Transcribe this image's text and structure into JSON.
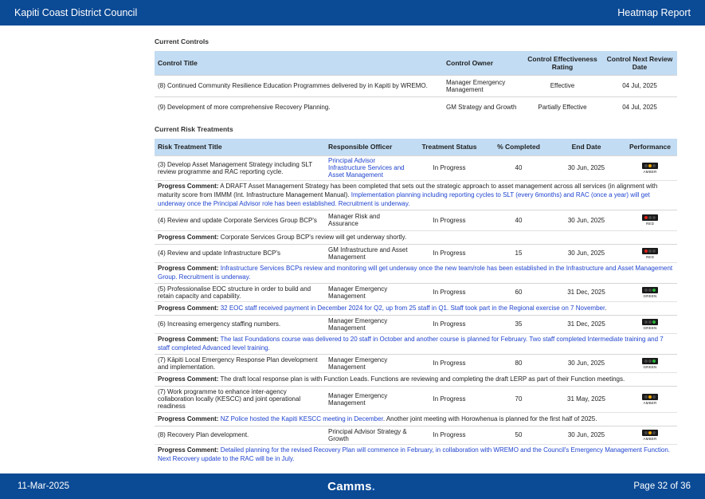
{
  "header": {
    "org": "Kapiti Coast District Council",
    "report": "Heatmap Report"
  },
  "footer": {
    "date": "11-Mar-2025",
    "brand": "Camms",
    "brand_dot": ".",
    "page": "Page 32 of 36"
  },
  "controls": {
    "section_title": "Current Controls",
    "columns": [
      "Control Title",
      "Control Owner",
      "Control Effectiveness Rating",
      "Control Next Review Date"
    ],
    "rows": [
      {
        "title": "(8) Continued Community Resilience Education Programmes delivered by in Kapiti by WREMO.",
        "owner": "Manager Emergency Management",
        "rating": "Effective",
        "date": "04 Jul, 2025"
      },
      {
        "title": "(9) Development of more comprehensive Recovery Planning.",
        "owner": "GM Strategy and Growth",
        "rating": "Partially Effective",
        "date": "04 Jul, 2025"
      }
    ]
  },
  "treatments": {
    "section_title": "Current Risk Treatments",
    "columns": [
      "Risk Treatment Title",
      "Responsible Officer",
      "Treatment Status",
      "% Completed",
      "End Date",
      "Performance"
    ],
    "comment_label": "Progress Comment:",
    "rows": [
      {
        "title": "(3) Develop Asset Management Strategy including SLT review programme and RAC reporting cycle.",
        "officer": "Principal Advisor Infrastructure Services and Asset Management",
        "officer_blue": true,
        "status": "In Progress",
        "percent": "40",
        "end": "30 Jun, 2025",
        "performance": "AMBER",
        "comment_plain": "A DRAFT Asset Management Strategy has been completed that sets out the strategic approach to asset management across all services (in alignment with maturity score from IMMM (Int. Infrastructure Management Manual).",
        "comment_blue": "Implementation planning including reporting cycles to SLT (every 6months) and RAC (once a year) will get underway once the Principal Advisor role has been established. Recruitment is underway.",
        "comment_tail": ""
      },
      {
        "title": "(4) Review and update Corporate Services Group BCP's",
        "officer": "Manager Risk and Assurance",
        "officer_blue": false,
        "status": "In Progress",
        "percent": "40",
        "end": "30 Jun, 2025",
        "performance": "RED",
        "comment_plain": "Corporate Services Group BCP's review will get underway shortly.",
        "comment_blue": "",
        "comment_tail": ""
      },
      {
        "title": "(4) Review and update Infrastructure BCP's",
        "officer": "GM Infrastructure and Asset Management",
        "officer_blue": false,
        "status": "In Progress",
        "percent": "15",
        "end": "30 Jun, 2025",
        "performance": "RED",
        "comment_plain": "",
        "comment_blue": "Infrastructure Services BCPs review and monitoring will get underway once the new team/role has been established in the Infrastructure and Asset Management Group.  Recruitment is underway.",
        "comment_tail": ""
      },
      {
        "title": "(5) Professionalise EOC structure in order to build and retain capacity and capability.",
        "officer": "Manager Emergency Management",
        "officer_blue": false,
        "status": "In Progress",
        "percent": "60",
        "end": "31 Dec, 2025",
        "performance": "GREEN",
        "comment_plain": "",
        "comment_blue": "32 EOC staff received payment in December 2024 for Q2, up from 25 staff in Q1. Staff took part in the Regional exercise on 7 November",
        "comment_tail": "."
      },
      {
        "title": "(6) Increasing emergency staffing numbers.",
        "officer": "Manager Emergency Management",
        "officer_blue": false,
        "status": "In Progress",
        "percent": "35",
        "end": "31 Dec, 2025",
        "performance": "GREEN",
        "comment_plain": "",
        "comment_blue": "The last Foundations course was delivered to 20 staff in October and another course is planned for February. Two staff completed Intermediate training and 7 staff completed Advanced level training.",
        "comment_tail": ""
      },
      {
        "title": "(7) Kāpiti Local Emergency Response Plan development and implementation.",
        "officer": "Manager Emergency Management",
        "officer_blue": false,
        "status": "In Progress",
        "percent": "80",
        "end": "30 Jun, 2025",
        "performance": "GREEN",
        "comment_plain": "The draft local response plan is with Function Leads. Functions are reviewing and completing the draft LERP as part of their Function meetings.",
        "comment_blue": "",
        "comment_tail": ""
      },
      {
        "title": "(7) Work programme to enhance inter-agency collaboration locally (KESCC) and joint operational readiness",
        "officer": "Manager Emergency Management",
        "officer_blue": false,
        "status": "In Progress",
        "percent": "70",
        "end": "31 May, 2025",
        "performance": "AMBER",
        "comment_plain": "",
        "comment_blue": "NZ Police hosted the Kapiti KESCC meeting in December",
        "comment_tail": ". Another joint meeting with Horowhenua is planned for the first half of 2025."
      },
      {
        "title": "(8) Recovery Plan development.",
        "officer": "Principal Advisor Strategy & Growth",
        "officer_blue": false,
        "status": "In Progress",
        "percent": "50",
        "end": "30 Jun, 2025",
        "performance": "AMBER",
        "comment_plain": "",
        "comment_blue": "Detailed planning for the revised Recovery Plan will commence in February, in collaboration with WREMO and the Council's Emergency Management Function. Next Recovery update to the RAC will be in July.",
        "comment_tail": ""
      }
    ]
  },
  "colors": {
    "header_bar": "#0b4a95",
    "table_header": "#c2dcf3",
    "link_blue": "#1f44cf",
    "red": "#e0211b",
    "amber": "#f0a500",
    "green": "#27b33a"
  }
}
